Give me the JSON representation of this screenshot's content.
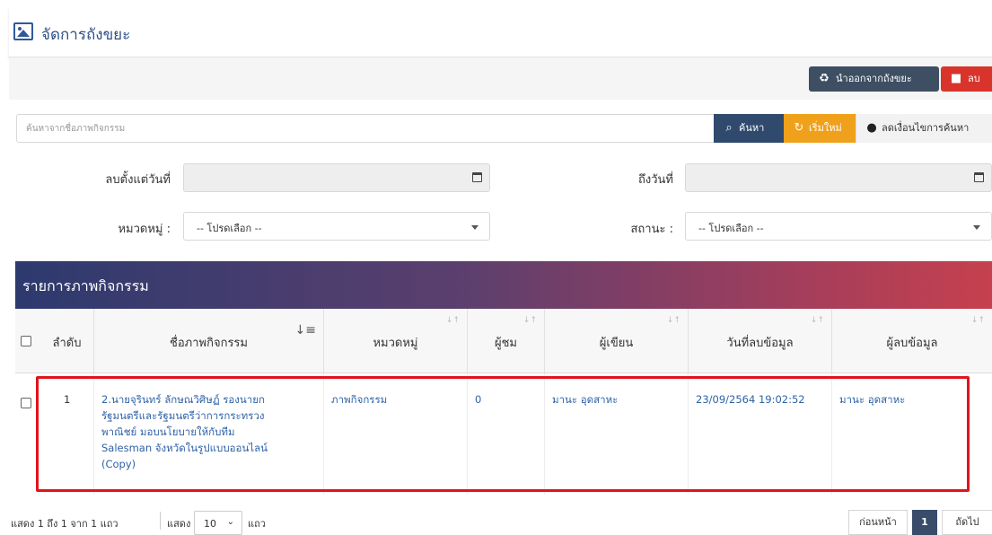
{
  "page": {
    "title": "จัดการถังขยะ"
  },
  "toolbar": {
    "restore_label": "นำออกจากถังขยะ",
    "delete_label": "ลบ"
  },
  "search": {
    "placeholder": "ค้นหาจากชื่อภาพกิจกรรม",
    "value": "",
    "find_label": "ค้นหา",
    "reset_label": "เริ่มใหม่",
    "less_label": "ลดเงื่อนไขการค้นหา"
  },
  "filters": {
    "deleted_from_label": "ลบตั้งแต่วันที่",
    "deleted_from_value": "",
    "to_date_label": "ถึงวันที่",
    "to_date_value": "",
    "category_label": "หมวดหมู่ :",
    "category_value": "-- โปรดเลือก --",
    "status_label": "สถานะ :",
    "status_value": "-- โปรดเลือก --"
  },
  "panel": {
    "title": "รายการภาพกิจกรรม"
  },
  "table": {
    "columns": [
      "ลำดับ",
      "ชื่อภาพกิจกรรม",
      "หมวดหมู่",
      "ผู้ชม",
      "ผู้เขียน",
      "วันที่ลบข้อมูล",
      "ผู้ลบข้อมูล"
    ],
    "rows": [
      {
        "index": "1",
        "name": "2.นายจุรินทร์ ลักษณวิศิษฏ์ รองนายกรัฐมนตรีและรัฐมนตรีว่าการกระทรวงพาณิชย์ มอบนโยบายให้กับทีม Salesman จังหวัดในรูปแบบออนไลน์ (Copy)",
        "name_lines": [
          "2.นายจุรินทร์ ลักษณวิศิษฏ์ รองนายก",
          "รัฐมนตรีและรัฐมนตรีว่าการกระทรวง",
          "พาณิชย์ มอบนโยบายให้กับทีม",
          "Salesman จังหวัดในรูปแบบออนไลน์",
          "(Copy)"
        ],
        "category": "ภาพกิจกรรม",
        "views": "0",
        "author": "มานะ อุดสาหะ",
        "deleted_date": "23/09/2564 19:02:52",
        "deleted_by": "มานะ อุดสาหะ"
      }
    ]
  },
  "footer": {
    "info": "แสดง 1 ถึง 1 จาก 1 แถว",
    "show_label": "แสดง",
    "page_size": "10",
    "rows_label": "แถว",
    "prev_label": "ก่อนหน้า",
    "current_page": "1",
    "next_label": "ถัดไป"
  },
  "colors": {
    "primary": "#2f4a6d",
    "warning": "#f0a11c",
    "danger": "#d9342b",
    "link": "#2f62a6",
    "highlight": "#e0141b"
  }
}
